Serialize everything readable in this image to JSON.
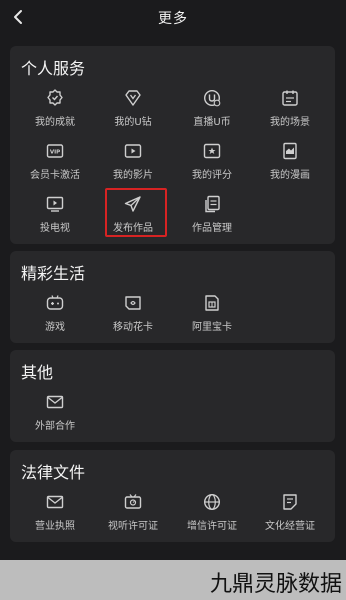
{
  "header": {
    "title": "更多",
    "back_icon": "chevron-left-icon"
  },
  "sections": [
    {
      "title": "个人服务",
      "items": [
        {
          "label": "我的成就",
          "icon": "medal-icon"
        },
        {
          "label": "我的U钻",
          "icon": "diamond-icon"
        },
        {
          "label": "直播U币",
          "icon": "coin-icon"
        },
        {
          "label": "我的场景",
          "icon": "calendar-icon"
        },
        {
          "label": "会员卡激活",
          "icon": "vip-card-icon"
        },
        {
          "label": "我的影片",
          "icon": "video-icon"
        },
        {
          "label": "我的评分",
          "icon": "rating-icon"
        },
        {
          "label": "我的漫画",
          "icon": "comic-icon"
        },
        {
          "label": "投电视",
          "icon": "tv-cast-icon"
        },
        {
          "label": "发布作品",
          "icon": "send-icon"
        },
        {
          "label": "作品管理",
          "icon": "manage-works-icon"
        }
      ]
    },
    {
      "title": "精彩生活",
      "items": [
        {
          "label": "游戏",
          "icon": "gamepad-icon"
        },
        {
          "label": "移动花卡",
          "icon": "sim-card-icon"
        },
        {
          "label": "阿里宝卡",
          "icon": "ali-card-icon"
        }
      ]
    },
    {
      "title": "其他",
      "items": [
        {
          "label": "外部合作",
          "icon": "mail-icon"
        }
      ]
    },
    {
      "title": "法律文件",
      "items": [
        {
          "label": "营业执照",
          "icon": "mail-icon"
        },
        {
          "label": "视听许可证",
          "icon": "tv-license-icon"
        },
        {
          "label": "增信许可证",
          "icon": "globe-icon"
        },
        {
          "label": "文化经营证",
          "icon": "document-icon"
        }
      ]
    }
  ],
  "highlight_color": "#d72323",
  "watermark": "九鼎灵脉数据"
}
